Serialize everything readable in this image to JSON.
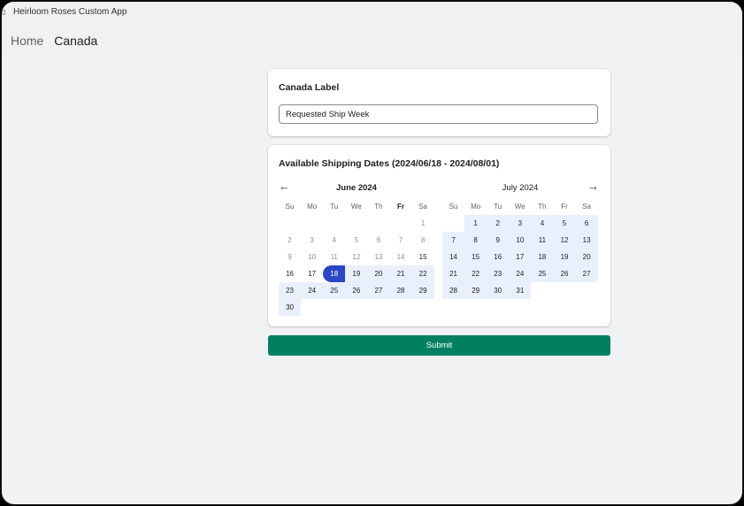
{
  "app": {
    "title": "Heirloom Roses Custom App"
  },
  "breadcrumb": {
    "home": "Home",
    "current": "Canada"
  },
  "label_card": {
    "title": "Canada Label",
    "input_value": "Requested Ship Week"
  },
  "dates_card": {
    "title": "Available Shipping Dates (2024/06/18 - 2024/08/01)",
    "prev_icon": "arrow-left-icon",
    "next_icon": "arrow-right-icon"
  },
  "weekdays": [
    "Su",
    "Mo",
    "Tu",
    "We",
    "Th",
    "Fr",
    "Sa"
  ],
  "calendars": [
    {
      "title": "June 2024",
      "first_weekday": 6,
      "days": 30,
      "range_start": 18,
      "range_end": 30,
      "selected": 18,
      "enabled_from": 15,
      "bold_weekday": 5
    },
    {
      "title": "July 2024",
      "first_weekday": 1,
      "days": 31,
      "range_start": 1,
      "range_end": 31,
      "selected": null,
      "enabled_from": 1,
      "bold_weekday": -1
    }
  ],
  "submit": {
    "label": "Submit"
  },
  "colors": {
    "primary": "#008060",
    "selected": "#2b47c6",
    "range": "#eaf0fb"
  }
}
